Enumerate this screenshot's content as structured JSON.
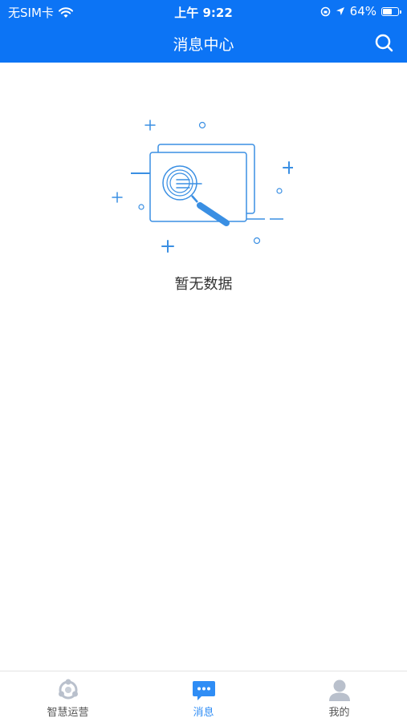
{
  "status_bar": {
    "carrier": "无SIM卡",
    "time": "上午 9:22",
    "battery_text": "64%",
    "battery_level": 0.64
  },
  "nav": {
    "title": "消息中心"
  },
  "empty_state": {
    "text": "暂无数据"
  },
  "tabs": [
    {
      "label": "智慧运营",
      "icon": "operations-icon",
      "active": false
    },
    {
      "label": "消息",
      "icon": "message-icon",
      "active": true
    },
    {
      "label": "我的",
      "icon": "profile-icon",
      "active": false
    }
  ],
  "colors": {
    "primary": "#0c74f5",
    "active_tab": "#2f8df5",
    "inactive_icon": "#b9c0cc",
    "illustration": "#3a8fe3"
  }
}
